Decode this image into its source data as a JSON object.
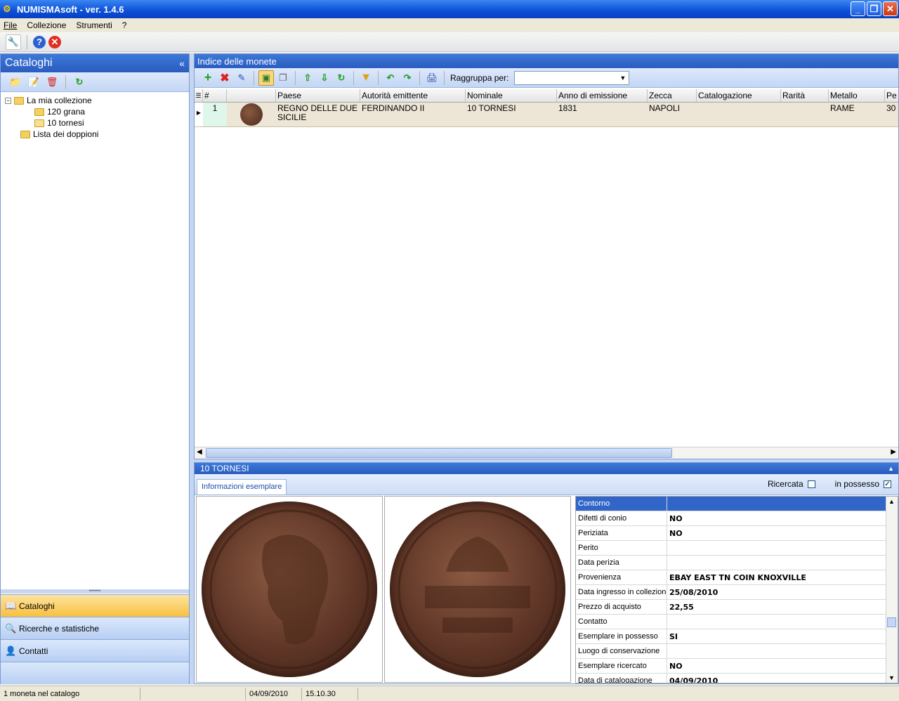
{
  "window": {
    "title": "NUMISMAsoft - ver. 1.4.6"
  },
  "menu": [
    "File",
    "Collezione",
    "Strumenti",
    "?"
  ],
  "left": {
    "title": "Cataloghi",
    "tree": [
      {
        "label": "La mia collezione"
      },
      {
        "label": "120 grana"
      },
      {
        "label": "10 tornesi"
      },
      {
        "label": "Lista dei doppioni"
      }
    ],
    "nav": [
      "Cataloghi",
      "Ricerche e statistiche",
      "Contatti"
    ]
  },
  "main": {
    "title": "Indice delle monete",
    "group_label": "Raggruppa per:",
    "group_value": "",
    "columns": [
      "#",
      "",
      "Paese",
      "Autorità emittente",
      "Nominale",
      "Anno di emissione",
      "Zecca",
      "Catalogazione",
      "Rarità",
      "Metallo",
      "Pe"
    ],
    "rows": [
      {
        "num": "1",
        "paese": "REGNO DELLE DUE SICILIE",
        "autorita": "FERDINANDO II",
        "nominale": "10 TORNESI",
        "anno": "1831",
        "zecca": "NAPOLI",
        "catalogazione": "",
        "rarita": "",
        "metallo": "RAME",
        "pe": "30"
      }
    ]
  },
  "detail": {
    "title": "10 TORNESI",
    "tab": "Informazioni esemplare",
    "ricercata_label": "Ricercata",
    "ricercata_checked": false,
    "possesso_label": "in possesso",
    "possesso_checked": true,
    "properties": [
      {
        "key": "Contorno",
        "value": ""
      },
      {
        "key": "Difetti di conio",
        "value": "NO"
      },
      {
        "key": "Periziata",
        "value": "NO"
      },
      {
        "key": "Perito",
        "value": ""
      },
      {
        "key": "Data perizia",
        "value": ""
      },
      {
        "key": "Provenienza",
        "value": "EBAY EAST TN COIN KNOXVILLE"
      },
      {
        "key": "Data ingresso in collezione",
        "value": "25/08/2010"
      },
      {
        "key": "Prezzo di acquisto",
        "value": "22,55"
      },
      {
        "key": "Contatto",
        "value": ""
      },
      {
        "key": "Esemplare in possesso",
        "value": "SI"
      },
      {
        "key": "Luogo di conservazione",
        "value": ""
      },
      {
        "key": "Esemplare ricercato",
        "value": "NO"
      },
      {
        "key": "Data di catalogazione",
        "value": "04/09/2010"
      }
    ]
  },
  "status": {
    "count": "1 moneta nel catalogo",
    "date": "04/09/2010",
    "time": "15.10.30"
  }
}
